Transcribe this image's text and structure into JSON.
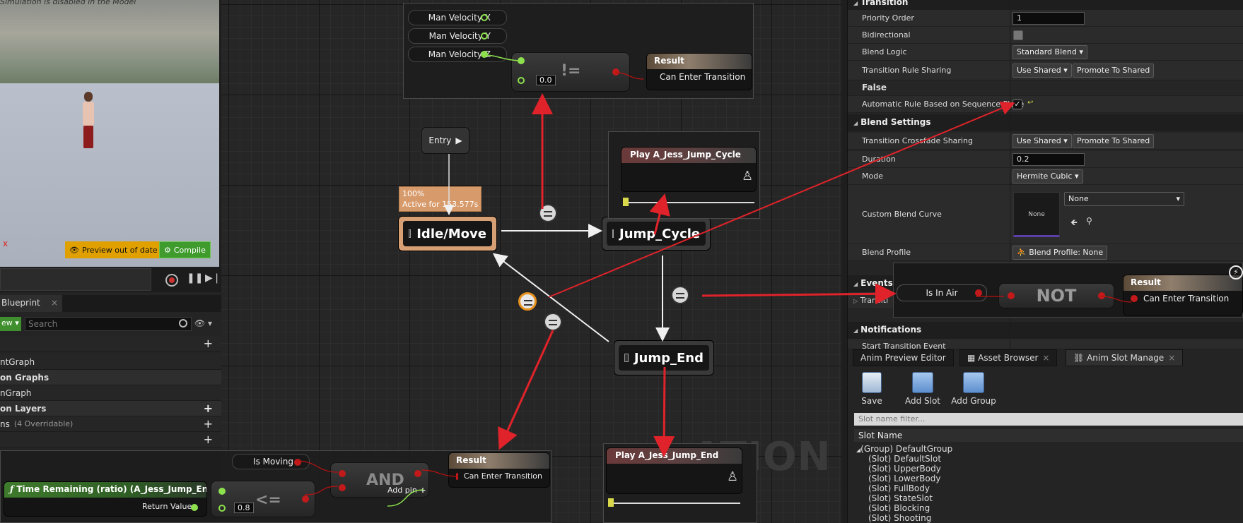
{
  "viewport": {
    "warning": "Simulation is disabled in the Model",
    "preview_badge": "Preview out of date",
    "compile": "Compile",
    "axis_x": "x"
  },
  "left_panel": {
    "tab": "Blueprint",
    "tab_close": "×",
    "view_btn": "ew ▾",
    "search_placeholder": "Search",
    "rows": [
      {
        "label": "ntGraph",
        "kind": "sub"
      },
      {
        "label": "on Graphs",
        "kind": "hdr"
      },
      {
        "label": "nGraph",
        "kind": "sub"
      },
      {
        "label": "on Layers",
        "kind": "hdr"
      },
      {
        "label": "ns",
        "muted": "(4 Overridable)",
        "kind": "sub"
      }
    ]
  },
  "graph": {
    "watermark": "ATION",
    "vars": [
      "Man Velocity X",
      "Man Velocity Y",
      "Man Velocity Z"
    ],
    "neq_value": "0.0",
    "neq_op": "!=",
    "result_title": "Result",
    "result_pin": "Can Enter Transition",
    "entry": "Entry",
    "tooltip_line1": "100%",
    "tooltip_line2": "Active for 153.577s",
    "states": {
      "idle": "Idle/Move",
      "jump_cycle": "Jump_Cycle",
      "jump_end": "Jump_End"
    },
    "play_cycle": "Play A_Jess_Jump_Cycle",
    "play_end": "Play A_Jess_Jump_End",
    "bottom": {
      "is_moving": "Is Moving",
      "and": "AND",
      "add_pin": "Add pin",
      "func_title": "Time Remaining (ratio) (A_Jess_Jump_End)",
      "return_value": "Return Value",
      "le_value": "0.8",
      "le_op": "<=",
      "result_title": "Result",
      "result_pin": "Can Enter Transition"
    }
  },
  "details": {
    "cat_transition": "Transition",
    "priority_label": "Priority Order",
    "priority_value": "1",
    "bidirectional_label": "Bidirectional",
    "blend_logic_label": "Blend Logic",
    "blend_logic_value": "Standard Blend",
    "rule_sharing_label": "Transition Rule Sharing",
    "use_shared": "Use Shared",
    "promote": "Promote To Shared",
    "false_label": "False",
    "auto_rule_label": "Automatic Rule Based on Sequence Playe",
    "cat_blend": "Blend Settings",
    "crossfade_label": "Transition Crossfade Sharing",
    "duration_label": "Duration",
    "duration_value": "0.2",
    "mode_label": "Mode",
    "mode_value": "Hermite Cubic",
    "curve_label": "Custom Blend Curve",
    "curve_thumb": "None",
    "curve_select": "None",
    "profile_label": "Blend Profile",
    "profile_value": "Blend Profile: None",
    "cat_events": "Events",
    "events_row": "Transiti",
    "cat_notifications": "Notifications",
    "start_transition": "Start Transition Event"
  },
  "events_overlay": {
    "is_in_air": "Is In Air",
    "not": "NOT",
    "result_title": "Result",
    "result_pin": "Can Enter Transition"
  },
  "bottom_right": {
    "tabs": [
      {
        "label": "Anim Preview Editor"
      },
      {
        "label": "Asset Browser"
      },
      {
        "label": "Anim Slot Manage"
      }
    ],
    "buttons": [
      "Save",
      "Add Slot",
      "Add Group"
    ],
    "filter_placeholder": "Slot name filter...",
    "column": "Slot Name",
    "group": "(Group) DefaultGroup",
    "slots": [
      "(Slot) DefaultSlot",
      "(Slot) UpperBody",
      "(Slot) LowerBody",
      "(Slot) FullBody",
      "(Slot) StateSlot",
      "(Slot) Blocking",
      "(Slot) Shooting"
    ]
  },
  "colors": {
    "accent_orange": "#e8921c",
    "exec_green": "#8de04d",
    "bool_red": "#c21a1a",
    "arrow_red": "#e0232a"
  }
}
